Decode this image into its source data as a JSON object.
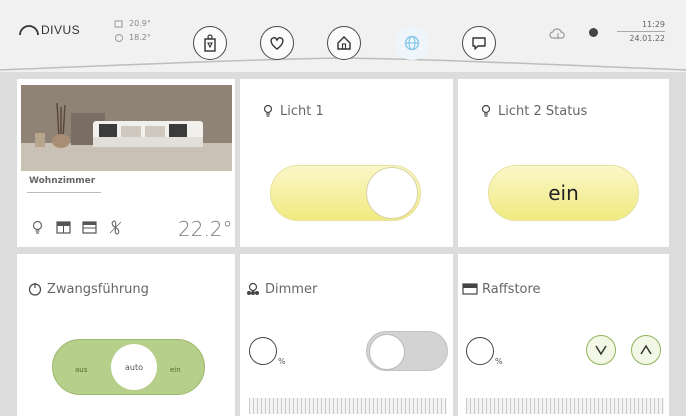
{
  "header": {
    "logo_text": "DIVUS",
    "weather": {
      "temp_outside": "20.9°",
      "temp_inside": "18.2°"
    },
    "nav": [
      {
        "name": "rooms",
        "icon": "person-door-icon"
      },
      {
        "name": "favorites",
        "icon": "heart-icon"
      },
      {
        "name": "home",
        "icon": "house-icon"
      },
      {
        "name": "globe",
        "icon": "globe-icon",
        "active": true
      },
      {
        "name": "messages",
        "icon": "chat-icon"
      }
    ],
    "time": "11:29",
    "date": "24.01.22"
  },
  "tiles": {
    "room": {
      "name": "Wohnzimmer",
      "temperature": "22.2°"
    },
    "licht1": {
      "title": "Licht 1",
      "state": "on"
    },
    "licht2": {
      "title": "Licht 2  Status",
      "state_label": "ein"
    },
    "zwang": {
      "title": "Zwangsführung",
      "off_label": "aus",
      "auto_label": "auto",
      "on_label": "ein"
    },
    "dimmer": {
      "title": "Dimmer",
      "unit": "%",
      "state": "off"
    },
    "raffstore": {
      "title": "Raffstore",
      "unit": "%"
    }
  },
  "colors": {
    "accent_yellow": "#f0ea80",
    "accent_green": "#b6cf8a",
    "active_nav": "#7fc3e8"
  }
}
